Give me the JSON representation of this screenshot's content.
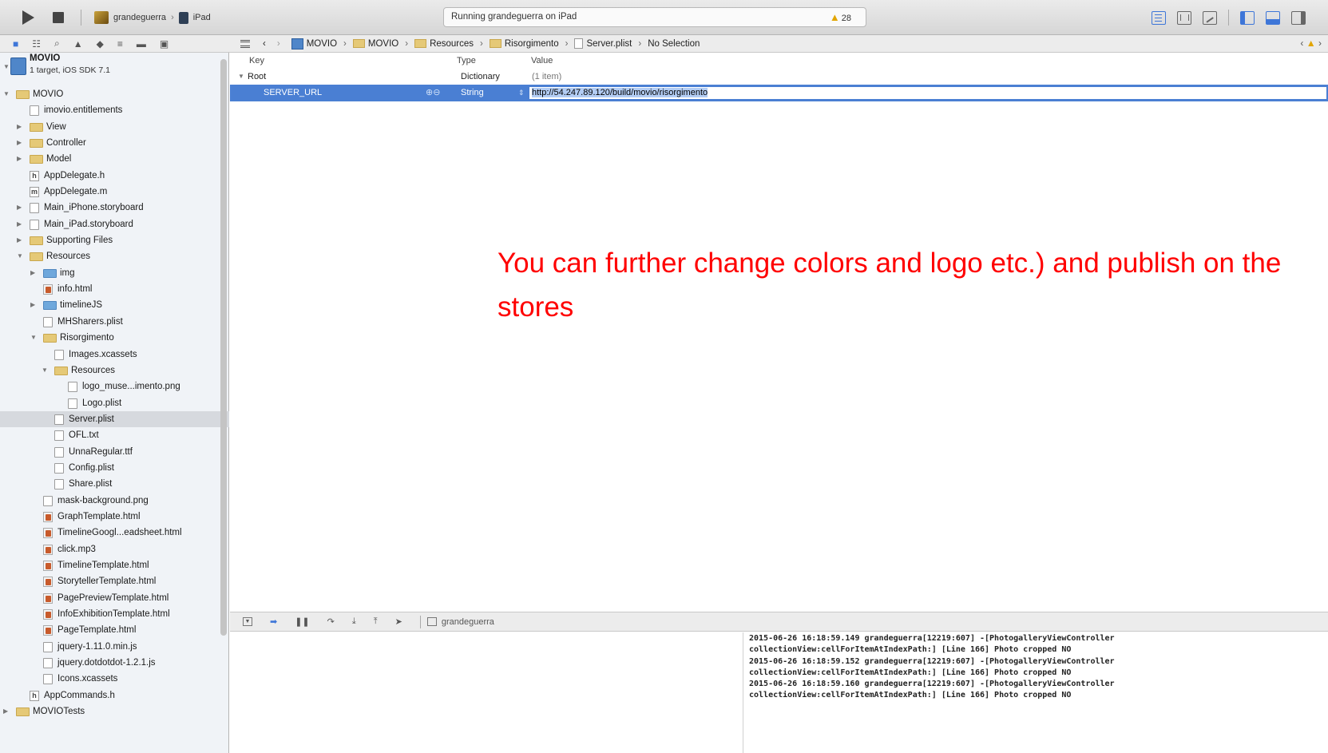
{
  "toolbar": {
    "scheme_name": "grandeguerra",
    "device_name": "iPad",
    "status_text": "Running grandeguerra on iPad",
    "warning_count": "28",
    "colors": {
      "accent": "#3e76d8",
      "warning": "#e2a500"
    }
  },
  "navigator": {
    "tabs": [
      "folder-icon",
      "symbol-icon",
      "search-icon",
      "issue-icon",
      "test-icon",
      "debug-icon",
      "breakpoint-icon",
      "log-icon"
    ],
    "project": {
      "name": "MOVIO",
      "subtitle": "1 target, iOS SDK 7.1"
    },
    "items": [
      {
        "label": "MOVIO",
        "indent": 1,
        "type": "folder",
        "expanded": true
      },
      {
        "label": "imovio.entitlements",
        "indent": 2,
        "type": "file"
      },
      {
        "label": "View",
        "indent": 2,
        "type": "folder",
        "expanded": false
      },
      {
        "label": "Controller",
        "indent": 2,
        "type": "folder",
        "expanded": false
      },
      {
        "label": "Model",
        "indent": 2,
        "type": "folder",
        "expanded": false
      },
      {
        "label": "AppDelegate.h",
        "indent": 2,
        "type": "h"
      },
      {
        "label": "AppDelegate.m",
        "indent": 2,
        "type": "m"
      },
      {
        "label": "Main_iPhone.storyboard",
        "indent": 2,
        "type": "storyboard",
        "expanded": false
      },
      {
        "label": "Main_iPad.storyboard",
        "indent": 2,
        "type": "storyboard",
        "expanded": false
      },
      {
        "label": "Supporting Files",
        "indent": 2,
        "type": "folder",
        "expanded": false
      },
      {
        "label": "Resources",
        "indent": 2,
        "type": "folder",
        "expanded": true
      },
      {
        "label": "img",
        "indent": 3,
        "type": "bluefolder",
        "expanded": false
      },
      {
        "label": "info.html",
        "indent": 3,
        "type": "html"
      },
      {
        "label": "timelineJS",
        "indent": 3,
        "type": "bluefolder",
        "expanded": false
      },
      {
        "label": "MHSharers.plist",
        "indent": 3,
        "type": "file"
      },
      {
        "label": "Risorgimento",
        "indent": 3,
        "type": "folder",
        "expanded": true
      },
      {
        "label": "Images.xcassets",
        "indent": 4,
        "type": "file"
      },
      {
        "label": "Resources",
        "indent": 4,
        "type": "folder",
        "expanded": true
      },
      {
        "label": "logo_muse...imento.png",
        "indent": 5,
        "type": "file"
      },
      {
        "label": "Logo.plist",
        "indent": 5,
        "type": "file"
      },
      {
        "label": "Server.plist",
        "indent": 4,
        "type": "file",
        "selected": true
      },
      {
        "label": "OFL.txt",
        "indent": 4,
        "type": "file"
      },
      {
        "label": "UnnaRegular.ttf",
        "indent": 4,
        "type": "file"
      },
      {
        "label": "Config.plist",
        "indent": 4,
        "type": "file"
      },
      {
        "label": "Share.plist",
        "indent": 4,
        "type": "file"
      },
      {
        "label": "mask-background.png",
        "indent": 3,
        "type": "file"
      },
      {
        "label": "GraphTemplate.html",
        "indent": 3,
        "type": "html"
      },
      {
        "label": "TimelineGoogl...eadsheet.html",
        "indent": 3,
        "type": "html"
      },
      {
        "label": "click.mp3",
        "indent": 3,
        "type": "html"
      },
      {
        "label": "TimelineTemplate.html",
        "indent": 3,
        "type": "html"
      },
      {
        "label": "StorytellerTemplate.html",
        "indent": 3,
        "type": "html"
      },
      {
        "label": "PagePreviewTemplate.html",
        "indent": 3,
        "type": "html"
      },
      {
        "label": "InfoExhibitionTemplate.html",
        "indent": 3,
        "type": "html"
      },
      {
        "label": "PageTemplate.html",
        "indent": 3,
        "type": "html"
      },
      {
        "label": "jquery-1.11.0.min.js",
        "indent": 3,
        "type": "file"
      },
      {
        "label": "jquery.dotdotdot-1.2.1.js",
        "indent": 3,
        "type": "file"
      },
      {
        "label": "Icons.xcassets",
        "indent": 3,
        "type": "file"
      },
      {
        "label": "AppCommands.h",
        "indent": 2,
        "type": "h"
      },
      {
        "label": "MOVIOTests",
        "indent": 1,
        "type": "folder",
        "expanded": false
      }
    ]
  },
  "jumpbar": {
    "crumbs": [
      "MOVIO",
      "MOVIO",
      "Resources",
      "Risorgimento",
      "Server.plist",
      "No Selection"
    ]
  },
  "plist": {
    "headers": {
      "key": "Key",
      "type": "Type",
      "value": "Value"
    },
    "rows": [
      {
        "key": "Root",
        "type": "Dictionary",
        "value": "(1 item)"
      },
      {
        "key": "SERVER_URL",
        "type": "String",
        "value": "http://54.247.89.120/build/movio/risorgimento"
      }
    ]
  },
  "annotation": "You can further change colors and logo etc.) and publish on the stores",
  "debugbar": {
    "target": "grandeguerra"
  },
  "console": {
    "lines": [
      "2015-06-26 16:18:59.149 grandeguerra[12219:607] -[PhotogalleryViewController",
      "collectionView:cellForItemAtIndexPath:] [Line 166] Photo cropped NO",
      "2015-06-26 16:18:59.152 grandeguerra[12219:607] -[PhotogalleryViewController",
      "collectionView:cellForItemAtIndexPath:] [Line 166] Photo cropped NO",
      "2015-06-26 16:18:59.160 grandeguerra[12219:607] -[PhotogalleryViewController",
      "collectionView:cellForItemAtIndexPath:] [Line 166] Photo cropped NO"
    ]
  }
}
